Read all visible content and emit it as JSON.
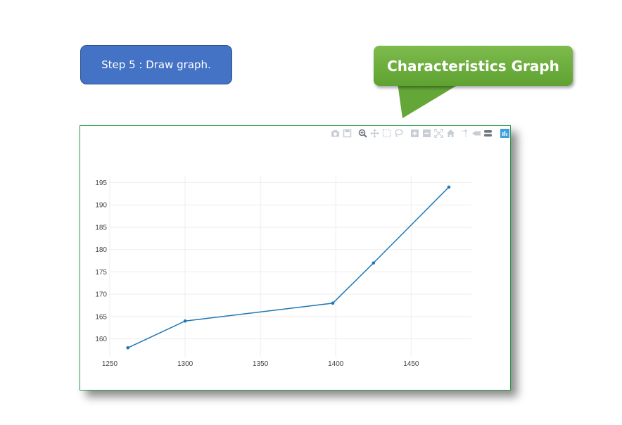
{
  "step": {
    "label": "Step 5 : Draw graph."
  },
  "callout": {
    "title": "Characteristics Graph"
  },
  "modebar": {
    "icons": [
      "camera-icon",
      "save-icon",
      "zoom-icon",
      "pan-icon",
      "box-select-icon",
      "lasso-icon",
      "zoom-in-icon",
      "zoom-out-icon",
      "autoscale-icon",
      "home-icon",
      "spike-lines-icon",
      "hover-closest-icon",
      "hover-compare-icon",
      "plotly-logo-icon"
    ]
  },
  "colors": {
    "line": "#1f77b4",
    "grid": "#eeeeee",
    "panel_border": "#2e9a4c",
    "step_bg": "#4472c4",
    "callout_bg": "#6aac3c"
  },
  "chart_data": {
    "type": "line",
    "x": [
      1262,
      1300,
      1398,
      1425,
      1475
    ],
    "series": [
      {
        "values": [
          158,
          164,
          168,
          177,
          194
        ]
      }
    ],
    "xlim": [
      1250,
      1490
    ],
    "ylim": [
      156,
      196.5
    ],
    "x_ticks": [
      1250,
      1300,
      1350,
      1400,
      1450
    ],
    "y_ticks": [
      160,
      165,
      170,
      175,
      180,
      185,
      190,
      195
    ],
    "grid": true,
    "markers": true
  }
}
